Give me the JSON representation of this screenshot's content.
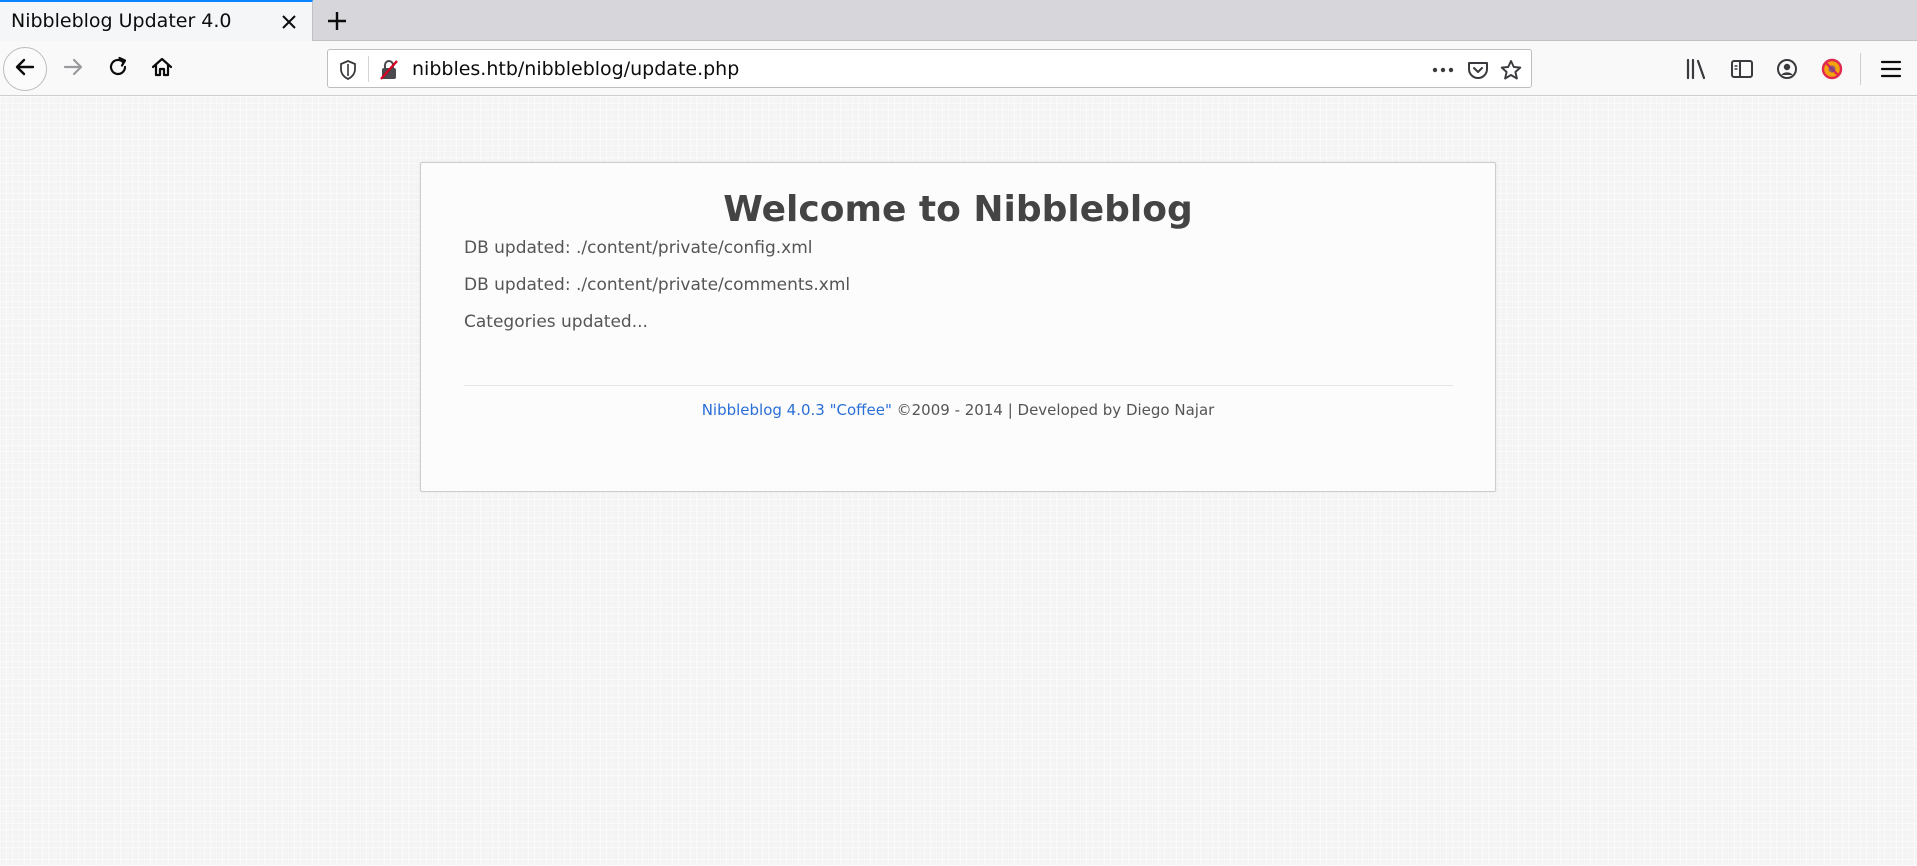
{
  "browser": {
    "tab": {
      "title": "Nibbleblog Updater 4.0"
    },
    "url": "nibbles.htb/nibbleblog/update.php"
  },
  "card": {
    "title": "Welcome to Nibbleblog",
    "log": [
      "DB updated: ./content/private/config.xml",
      "DB updated: ./content/private/comments.xml",
      "Categories updated..."
    ],
    "footer": {
      "link_text": "Nibbleblog 4.0.3 \"Coffee\"",
      "rest_text": " ©2009 - 2014 | Developed by Diego Najar"
    }
  },
  "icons": {
    "back": "arrow-left-icon",
    "forward": "arrow-right-icon",
    "reload": "reload-icon",
    "home": "home-icon",
    "shield": "shield-icon",
    "insecure": "insecure-lock-icon",
    "more": "ellipsis-icon",
    "pocket": "pocket-icon",
    "bookmark": "star-icon",
    "library": "library-icon",
    "sidebar": "sidebar-icon",
    "account": "account-icon",
    "addon": "blocked-addon-icon",
    "menu": "hamburger-menu-icon"
  },
  "colors": {
    "link": "#2a6fd6",
    "tab_accent": "#0a84ff",
    "addon_red": "#e22850",
    "addon_orange": "#f4a30c"
  }
}
